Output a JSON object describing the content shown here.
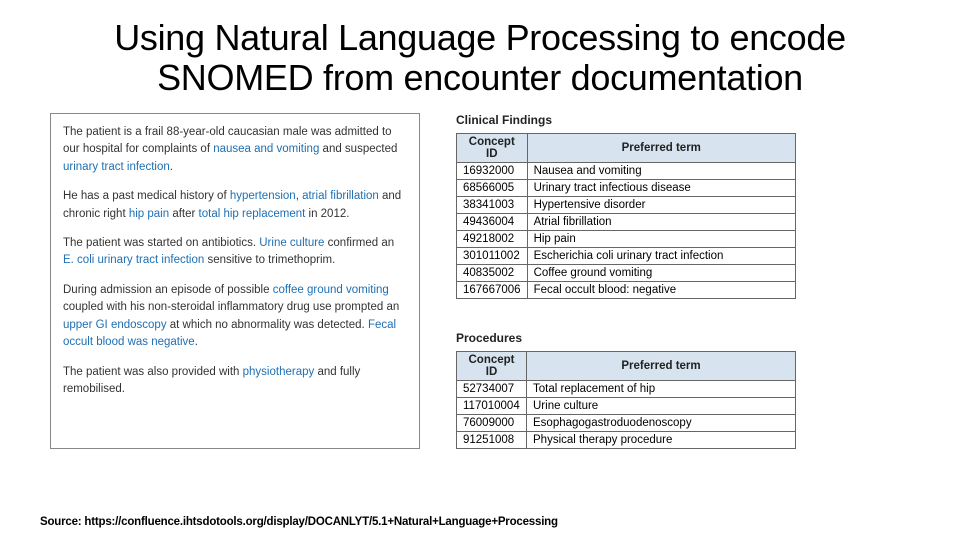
{
  "title": "Using Natural Language Processing to encode SNOMED from encounter documentation",
  "narrative": {
    "p1a": "The patient is a frail 88-year-old caucasian male was admitted to our hospital for complaints of ",
    "p1_h1": "nausea and vomiting",
    "p1b": " and suspected ",
    "p1_h2": "urinary tract infection",
    "p1c": ".",
    "p2a": "He has a past medical history of ",
    "p2_h1": "hypertension",
    "p2b": ", ",
    "p2_h2": "atrial fibrillation",
    "p2c": " and chronic right ",
    "p2_h3": "hip pain",
    "p2d": " after ",
    "p2_h4": "total hip replacement",
    "p2e": " in 2012.",
    "p3a": "The patient was started on antibiotics. ",
    "p3_h1": "Urine culture",
    "p3b": " confirmed an ",
    "p3_h2": "E. coli urinary tract infection",
    "p3c": " sensitive to trimethoprim.",
    "p4a": "During admission an episode of possible ",
    "p4_h1": "coffee ground vomiting",
    "p4b": " coupled with his non-steroidal inflammatory drug use prompted an ",
    "p4_h2": "upper GI endoscopy",
    "p4c": " at which no abnormality was detected. ",
    "p4_h3": "Fecal occult blood was negative",
    "p4d": ".",
    "p5a": "The patient was also provided with ",
    "p5_h1": "physiotherapy",
    "p5b": " and fully remobilised."
  },
  "findings": {
    "title": "Clinical Findings",
    "col1": "Concept ID",
    "col2": "Preferred term",
    "rows": [
      {
        "id": "16932000",
        "term": "Nausea and vomiting"
      },
      {
        "id": "68566005",
        "term": "Urinary tract infectious disease"
      },
      {
        "id": "38341003",
        "term": "Hypertensive disorder"
      },
      {
        "id": "49436004",
        "term": "Atrial fibrillation"
      },
      {
        "id": "49218002",
        "term": "Hip pain"
      },
      {
        "id": "301011002",
        "term": "Escherichia coli urinary tract infection"
      },
      {
        "id": "40835002",
        "term": "Coffee ground vomiting"
      },
      {
        "id": "167667006",
        "term": "Fecal occult blood: negative"
      }
    ]
  },
  "procedures": {
    "title": "Procedures",
    "col1": "Concept ID",
    "col2": "Preferred term",
    "rows": [
      {
        "id": "52734007",
        "term": "Total replacement of hip"
      },
      {
        "id": "117010004",
        "term": "Urine culture"
      },
      {
        "id": "76009000",
        "term": "Esophagogastroduodenoscopy"
      },
      {
        "id": "91251008",
        "term": "Physical therapy procedure"
      }
    ]
  },
  "source_label": "Source: ",
  "source_url": "https://confluence.ihtsdotools.org/display/DOCANLYT/5.1+Natural+Language+Processing"
}
